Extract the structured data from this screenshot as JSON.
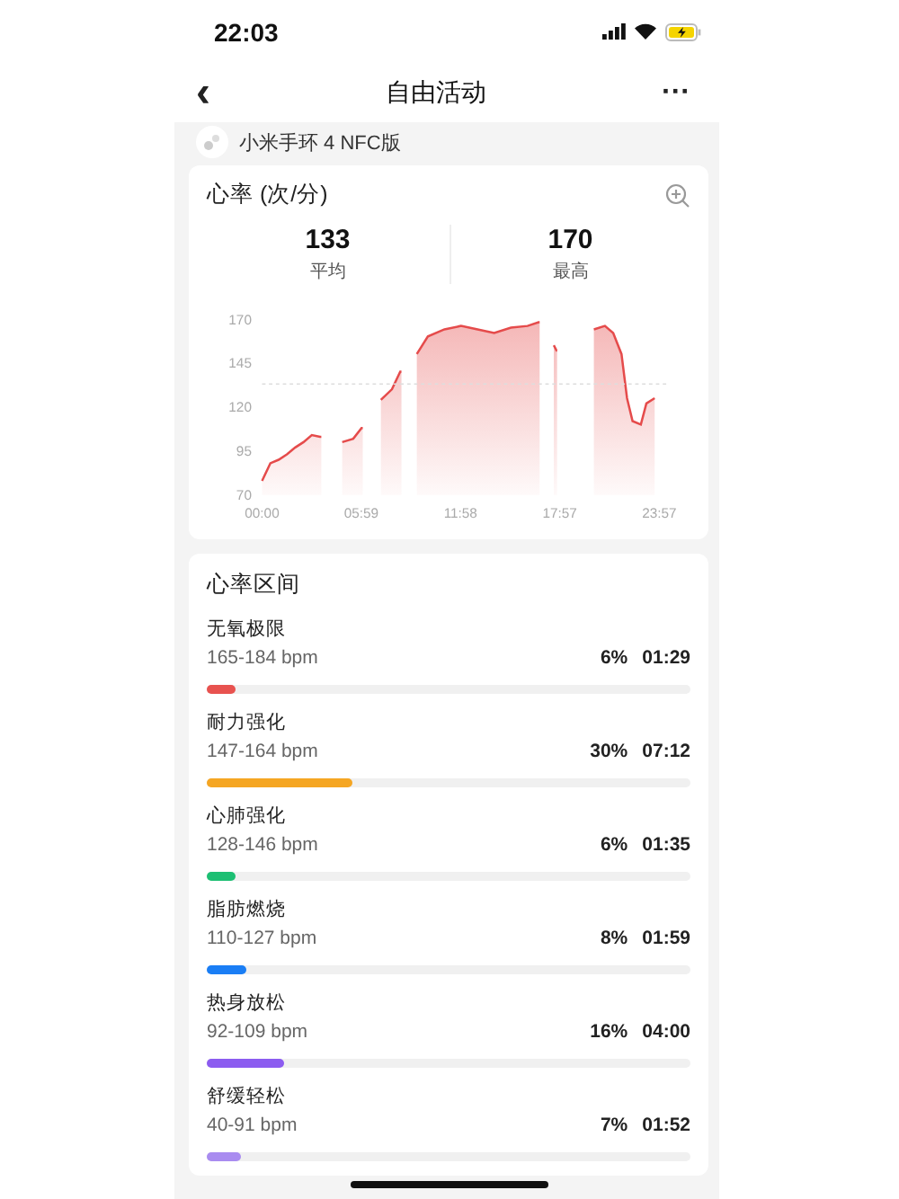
{
  "status_bar": {
    "time": "22:03"
  },
  "nav": {
    "back": "‹",
    "title": "自由活动",
    "more": "···"
  },
  "device": {
    "name": "小米手环 4 NFC版"
  },
  "heart_rate": {
    "title": "心率 (次/分)",
    "stats": [
      {
        "value": "133",
        "label": "平均"
      },
      {
        "value": "170",
        "label": "最高"
      }
    ],
    "chart_data": {
      "type": "area",
      "xlim": [
        0,
        1437
      ],
      "ylim": [
        70,
        170
      ],
      "yticks": [
        70,
        95,
        120,
        145,
        170
      ],
      "xticks": [
        {
          "value": 0,
          "label": "00:00"
        },
        {
          "value": 359,
          "label": "05:59"
        },
        {
          "value": 718,
          "label": "11:58"
        },
        {
          "value": 1077,
          "label": "17:57"
        },
        {
          "value": 1437,
          "label": "23:57"
        }
      ],
      "x": [
        0,
        30,
        60,
        90,
        120,
        150,
        180,
        210,
        214,
        290,
        330,
        360,
        364,
        430,
        470,
        500,
        504,
        560,
        600,
        660,
        720,
        780,
        840,
        900,
        960,
        1000,
        1004,
        1055,
        1065,
        1067,
        1200,
        1240,
        1270,
        1300,
        1320,
        1340,
        1370,
        1390,
        1420
      ],
      "series": [
        {
          "color": "#e54b4b",
          "values": [
            78,
            88,
            90,
            93,
            97,
            100,
            104,
            103,
            null,
            100,
            102,
            108,
            null,
            124,
            130,
            140,
            null,
            150,
            160,
            164,
            166,
            164,
            162,
            165,
            166,
            168,
            null,
            155,
            152,
            null,
            164,
            166,
            162,
            150,
            125,
            112,
            110,
            122,
            125
          ]
        }
      ],
      "ref_lines": [
        {
          "axis": "y",
          "value": 133
        }
      ]
    }
  },
  "zones": {
    "title": "心率区间",
    "items": [
      {
        "name": "无氧极限",
        "range": "165-184 bpm",
        "percent": "6%",
        "duration": "01:29",
        "level": 0.06,
        "color": "#e8524f"
      },
      {
        "name": "耐力强化",
        "range": "147-164 bpm",
        "percent": "30%",
        "duration": "07:12",
        "level": 0.3,
        "color": "#f5a623"
      },
      {
        "name": "心肺强化",
        "range": "128-146 bpm",
        "percent": "6%",
        "duration": "01:35",
        "level": 0.06,
        "color": "#1dbf73"
      },
      {
        "name": "脂肪燃烧",
        "range": "110-127 bpm",
        "percent": "8%",
        "duration": "01:59",
        "level": 0.08,
        "color": "#1a7ef5"
      },
      {
        "name": "热身放松",
        "range": "92-109 bpm",
        "percent": "16%",
        "duration": "04:00",
        "level": 0.16,
        "color": "#8c5cf0"
      },
      {
        "name": "舒缓轻松",
        "range": "40-91 bpm",
        "percent": "7%",
        "duration": "01:52",
        "level": 0.07,
        "color": "#a98cf0"
      }
    ]
  }
}
